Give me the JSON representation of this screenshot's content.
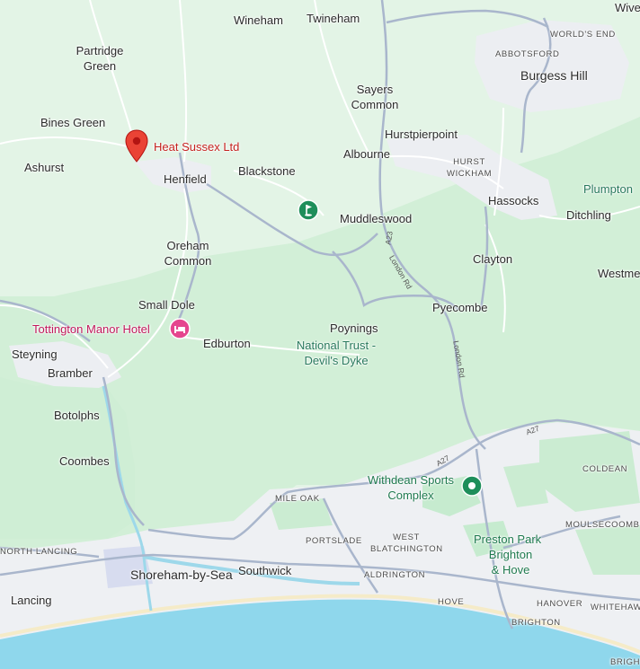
{
  "map": {
    "colors": {
      "land": "#e3f4e6",
      "park": "#cdeed3",
      "urban": "#eef0f3",
      "sea": "#8fd7ec",
      "road": "#a9b6cc",
      "pin_red": "#ea4335",
      "pin_pink": "#e5458e",
      "pin_green": "#1e8e5a"
    },
    "markers": {
      "business": {
        "label": "Heat Sussex Ltd",
        "icon": "red-location-pin-icon"
      },
      "hotel": {
        "label": "Tottington Manor Hotel",
        "icon": "hotel-bed-icon"
      },
      "golf": {
        "icon": "golf-icon"
      },
      "sports": {
        "label": "Withdean Sports Complex",
        "icon": "sports-venue-icon"
      }
    },
    "places": {
      "wineham": "Wineham",
      "twineham": "Twineham",
      "wives": "Wive",
      "worlds_end": "WORLD'S END",
      "partridge_green": "Partridge Green",
      "abbotsford": "ABBOTSFORD",
      "burgess_hill": "Burgess Hill",
      "sayers_common": "Sayers Common",
      "bines_green": "Bines Green",
      "hurstpierpoint": "Hurstpierpoint",
      "ashurst": "Ashurst",
      "albourne": "Albourne",
      "hurst_wickham": "HURST WICKHAM",
      "henfield": "Henfield",
      "blackstone": "Blackstone",
      "plumpton": "Plumpton",
      "hassocks": "Hassocks",
      "muddleswood": "Muddleswood",
      "ditchling": "Ditchling",
      "oreham_common": "Oreham Common",
      "clayton": "Clayton",
      "westmeston": "Westme",
      "small_dole": "Small Dole",
      "pyecombe": "Pyecombe",
      "poynings": "Poynings",
      "edburton": "Edburton",
      "devils_dyke": "National Trust - Devil's Dyke",
      "steyning": "Steyning",
      "bramber": "Bramber",
      "botolphs": "Botolphs",
      "coombes": "Coombes",
      "coldean": "COLDEAN",
      "mile_oak": "MILE OAK",
      "moulsecoomb": "MOULSECOOMB",
      "north_lancing": "NORTH LANCING",
      "portslade": "PORTSLADE",
      "west_blatchington": "WEST BLATCHINGTON",
      "preston_park": "Preston Park",
      "shoreham": "Shoreham-by-Sea",
      "southwick": "Southwick",
      "aldrington": "ALDRINGTON",
      "brighton_hove": "Brighton & Hove",
      "lancing": "Lancing",
      "hove": "HOVE",
      "hanover": "HANOVER",
      "whitehawk": "WHITEHAW",
      "brighton": "BRIGHTON",
      "brighton_corner": "BRIGHT"
    },
    "roads": {
      "a23": "A23",
      "london_rd_1": "London Rd",
      "london_rd_2": "London Rd",
      "a27_1": "A27",
      "a27_2": "A27"
    }
  }
}
